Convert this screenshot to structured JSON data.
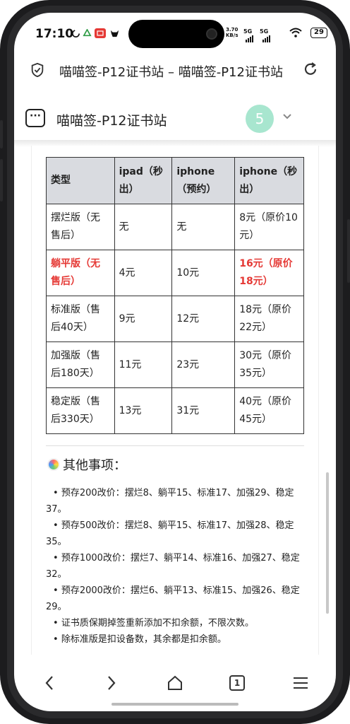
{
  "status_bar": {
    "time": "17:10",
    "net_speed_value": "3.70",
    "net_speed_unit": "KB/s",
    "signal1": "5G",
    "signal2": "5G",
    "battery": "29"
  },
  "browser": {
    "page_url_title": "喵喵签-P12证书站 – 喵喵签-P12证书站",
    "tab_title": "喵喵签-P12证书站",
    "tab_count": "5",
    "menu_glyph": "···"
  },
  "table": {
    "headers": [
      "类型",
      "ipad（秒出）",
      "iphone（预约）",
      "iphone（秒出）"
    ],
    "rows": [
      [
        "摆烂版（无售后）",
        "无",
        "无",
        "8元（原价10元）"
      ],
      [
        "躺平版（无售后）",
        "4元",
        "10元",
        "16元（原价18元）"
      ],
      [
        "标准版（售后40天）",
        "9元",
        "12元",
        "18元（原价22元）"
      ],
      [
        "加强版（售后180天）",
        "11元",
        "23元",
        "30元（原价35元）"
      ],
      [
        "稳定版（售后330天）",
        "13元",
        "31元",
        "40元（原价45元）"
      ]
    ]
  },
  "other": {
    "heading": "其他事项：",
    "notes": [
      "预存200改价：摆烂8、躺平15、标准17、加强29、稳定37。",
      "预存500改价：摆烂8、躺平15、标准17、加强28、稳定35。",
      "预存1000改价：摆烂7、躺平14、标准16、加强27、稳定32。",
      "预存2000改价：摆烂6、躺平13、标准15、加强26、稳定29。",
      "证书质保期掉签重新添加不扣余额，不限次数。",
      "除标准版是扣设备数，其余都是扣余额。"
    ]
  },
  "bottom_nav": {
    "tabs_count": "1"
  },
  "colors": {
    "highlight": "#e53935",
    "header_bg": "#d9dbe0",
    "badge_bg": "#a8e6cf"
  }
}
